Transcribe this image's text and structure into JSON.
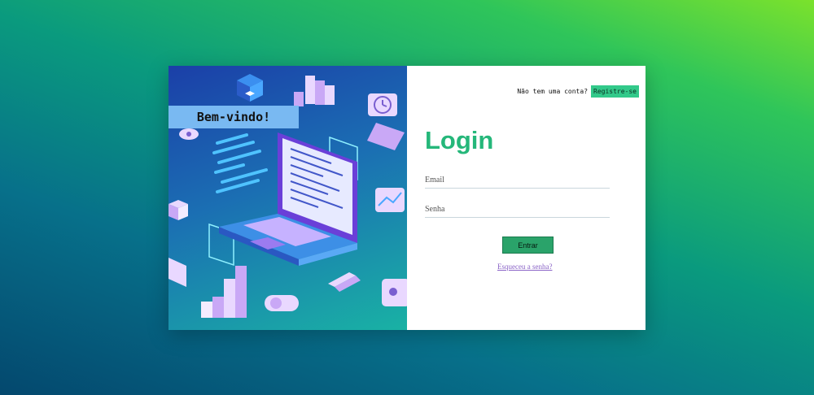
{
  "welcome": {
    "text": "Bem-vindo!"
  },
  "header": {
    "question": "Não tem uma conta?",
    "signup_label": "Registre-se"
  },
  "login": {
    "title": "Login",
    "email_placeholder": "Email",
    "password_placeholder": "Senha",
    "submit_label": "Entrar",
    "forgot_label": "Esqueceu a senha?"
  },
  "colors": {
    "accent_green": "#25b77a",
    "signup_bg": "#32c98a",
    "welcome_bg": "#79b9f2",
    "link_purple": "#8a63c7"
  },
  "illustration": {
    "icon": "isometric-laptop-code-icon"
  }
}
